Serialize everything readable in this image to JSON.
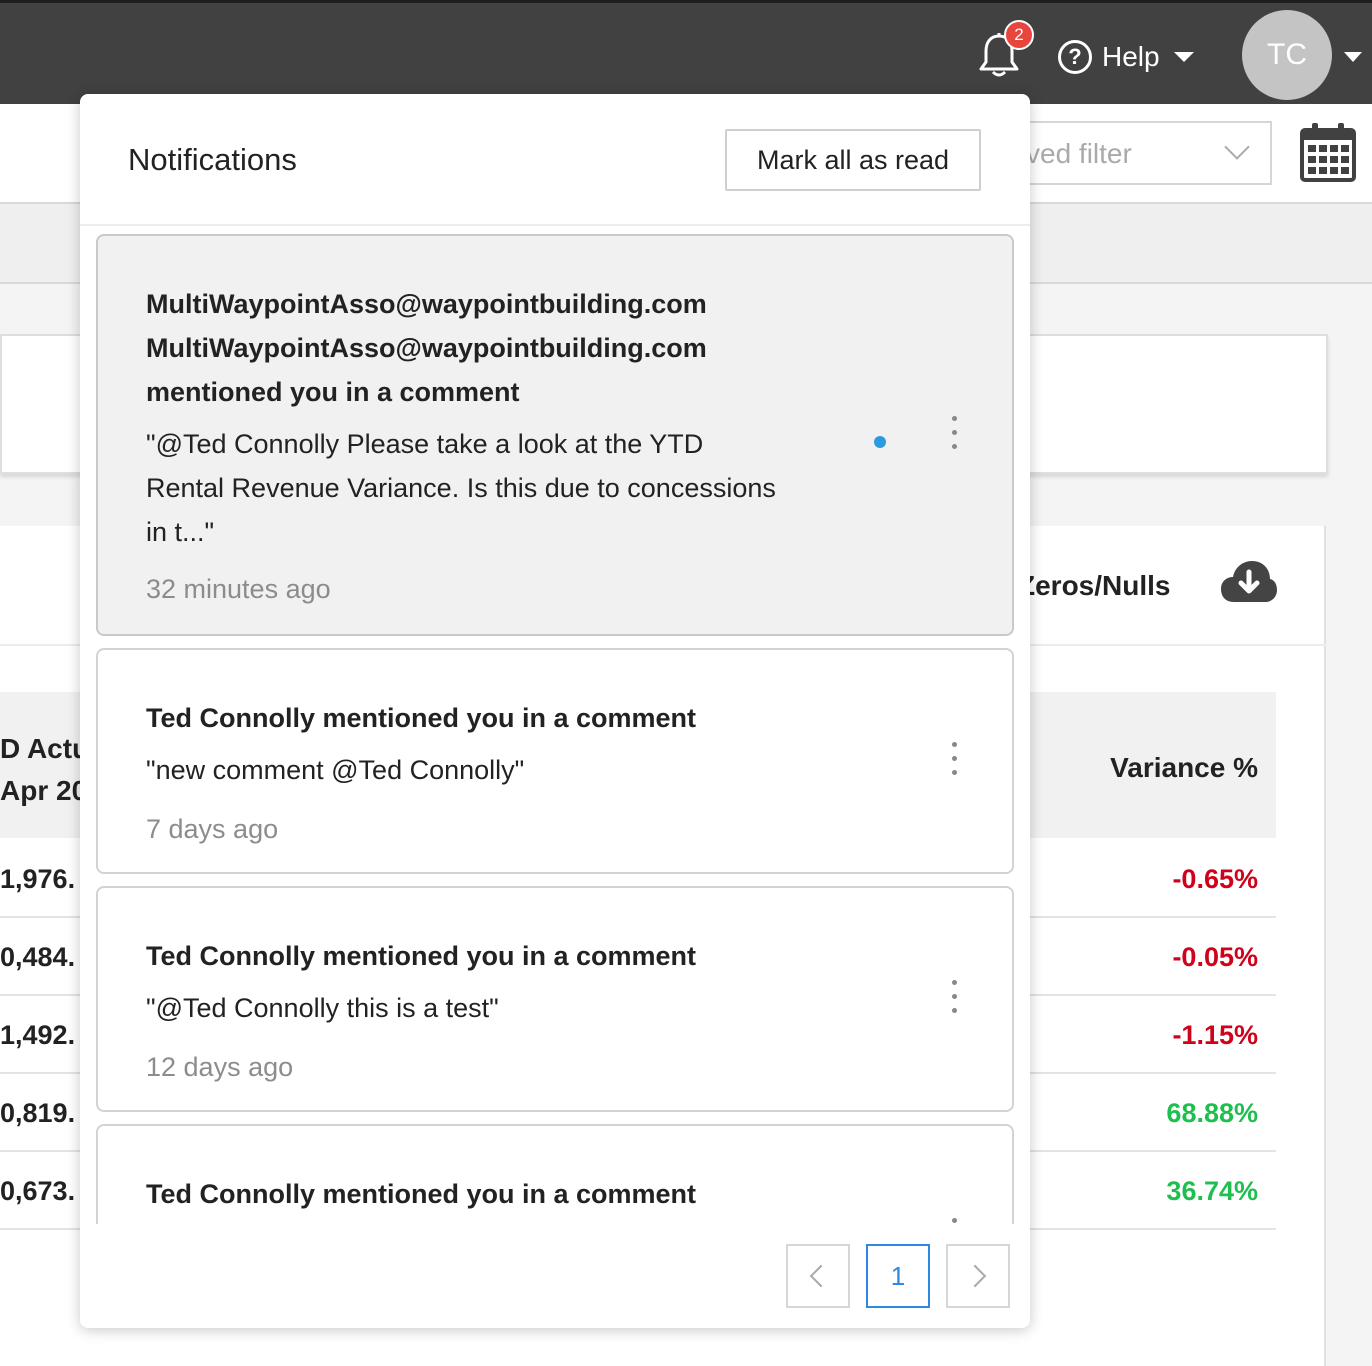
{
  "topbar": {
    "notification_count": "2",
    "help_label": "Help",
    "avatar_initials": "TC",
    "bg_color": "#414141",
    "badge_color": "#e8463c"
  },
  "toolbar": {
    "saved_filter_text": "ved filter"
  },
  "report": {
    "zeros_label": "Zeros/Nulls",
    "left_header_line1": "D Actu",
    "left_header_line2": "Apr 20",
    "variance_header": "Variance %",
    "rows": [
      {
        "left": "1,976.",
        "variance": "-0.65%",
        "status": "negative"
      },
      {
        "left": "0,484.",
        "variance": "-0.05%",
        "status": "negative"
      },
      {
        "left": "1,492.",
        "variance": "-1.15%",
        "status": "negative"
      },
      {
        "left": "0,819.",
        "variance": "68.88%",
        "status": "positive"
      },
      {
        "left": "0,673.",
        "variance": "36.74%",
        "status": "positive"
      }
    ]
  },
  "notifications": {
    "title": "Notifications",
    "mark_all_label": "Mark all as read",
    "items": [
      {
        "title": "MultiWaypointAsso@waypointbuilding.com MultiWaypointAsso@waypointbuilding.com mentioned you in a comment",
        "body": "\"@Ted Connolly Please take a look at the YTD Rental Revenue Variance. Is this due to concessions in t...\"",
        "time": "32 minutes ago",
        "unread": true
      },
      {
        "title": "Ted Connolly mentioned you in a comment",
        "body": "\"new comment @Ted Connolly\"",
        "time": "7 days ago",
        "unread": false
      },
      {
        "title": "Ted Connolly mentioned you in a comment",
        "body": "\"@Ted Connolly this is a test\"",
        "time": "12 days ago",
        "unread": false
      },
      {
        "title": "Ted Connolly mentioned you in a comment",
        "unread": false
      }
    ],
    "pagination": {
      "current_page": "1"
    },
    "unread_dot_color": "#2d9ae0"
  }
}
